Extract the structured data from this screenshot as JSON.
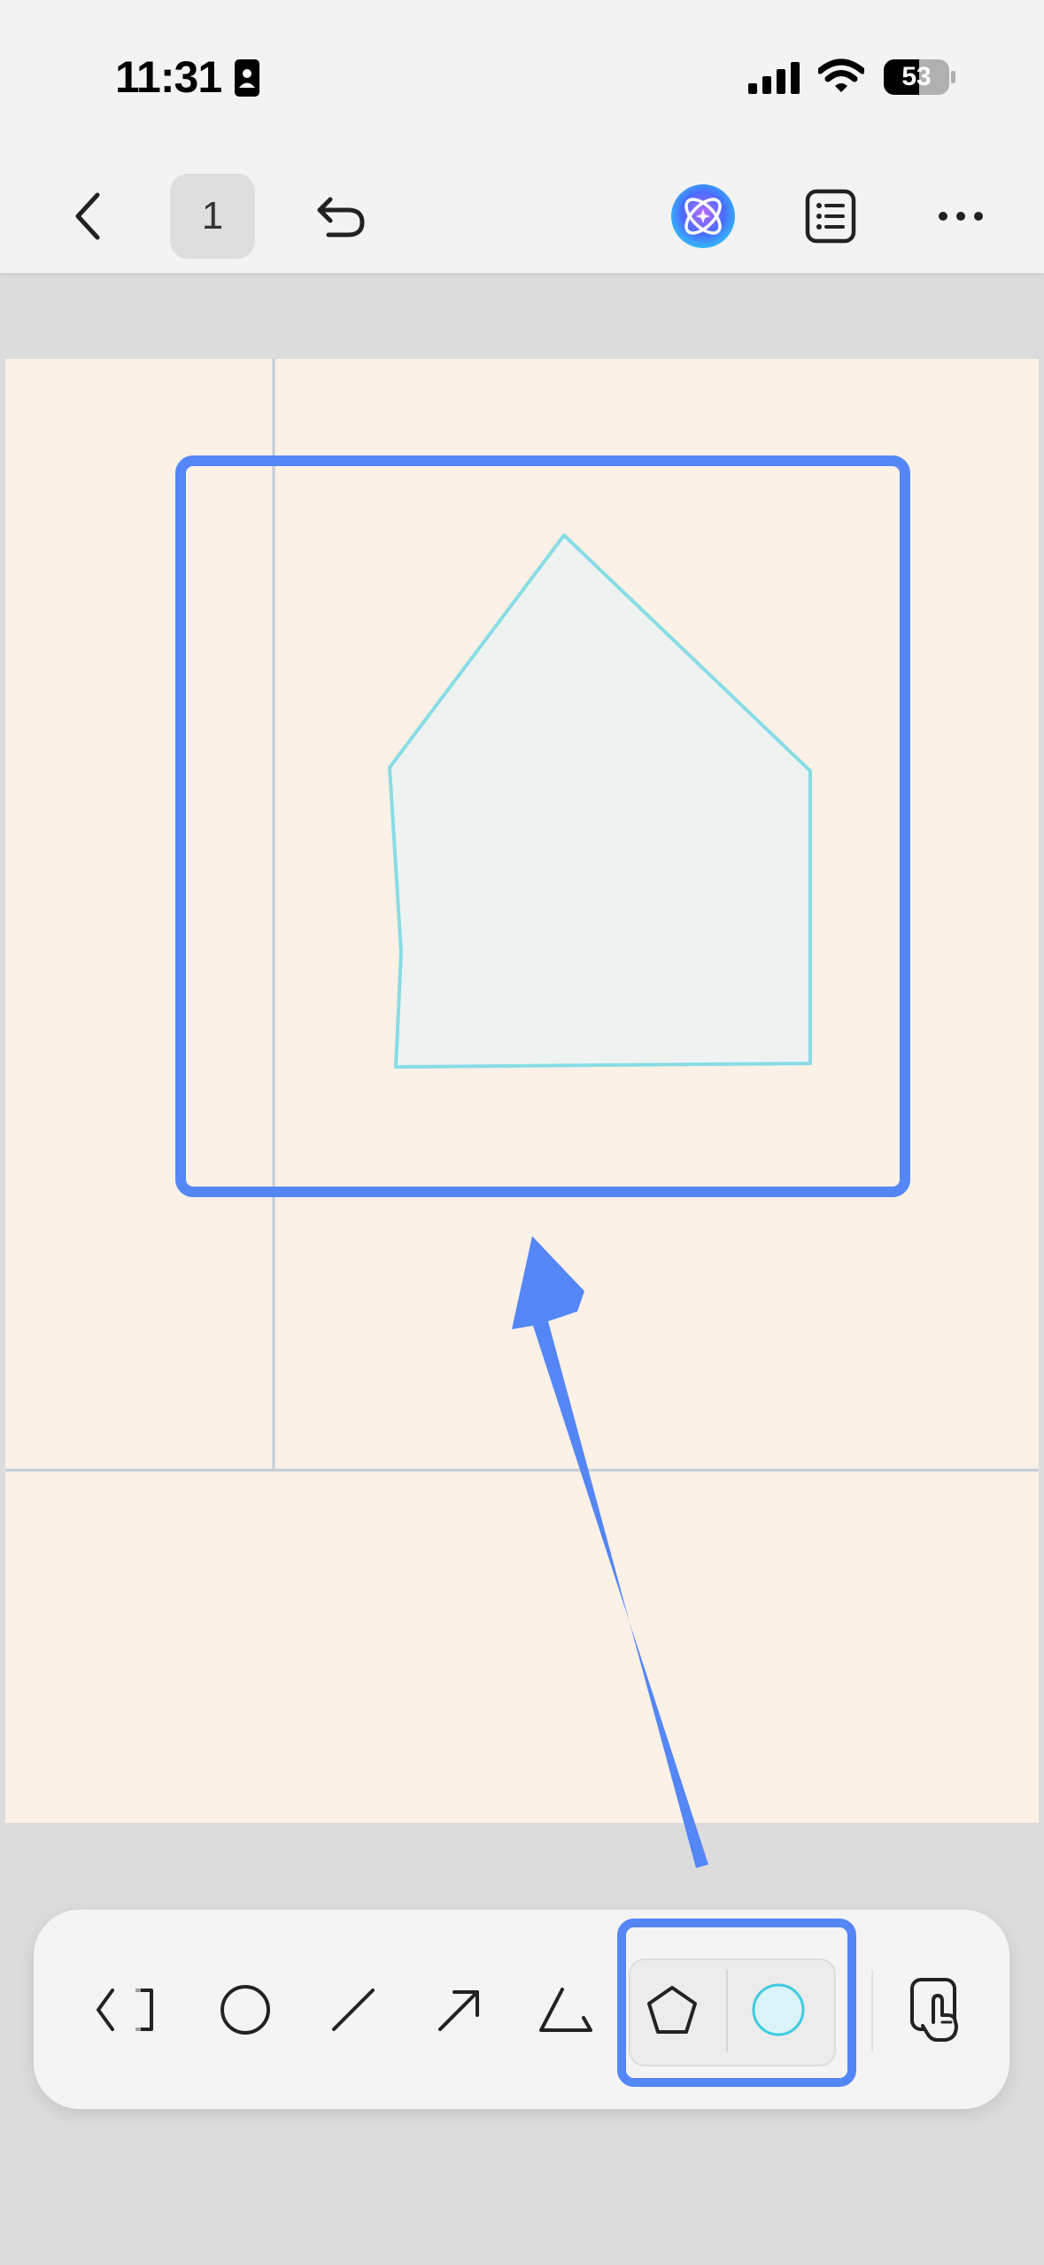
{
  "status_bar": {
    "time": "11:31",
    "battery_level": "53",
    "icons": [
      "contact-card-icon",
      "cellular-signal-icon",
      "wifi-icon",
      "battery-icon"
    ]
  },
  "nav_bar": {
    "page_number": "1",
    "icons": [
      "back-chevron-icon",
      "undo-icon",
      "ai-assistant-icon",
      "list-icon",
      "more-icon"
    ]
  },
  "canvas": {
    "background_color": "#fbf1e6",
    "guide_line_color": "#c4ccd6",
    "pentagon_stroke_color": "#88dce6",
    "pentagon_fill_color": "#eef3f1"
  },
  "toolbar": {
    "tools": [
      {
        "name": "eraser-select-tool",
        "icon": "bracket-icon"
      },
      {
        "name": "circle-tool",
        "icon": "circle-icon"
      },
      {
        "name": "line-tool",
        "icon": "line-icon"
      },
      {
        "name": "arrow-tool",
        "icon": "arrow-icon"
      },
      {
        "name": "triangle-tool",
        "icon": "triangle-icon"
      },
      {
        "name": "pentagon-tool",
        "icon": "pentagon-icon"
      },
      {
        "name": "color-swatch",
        "icon": "color-circle-icon",
        "color": "#d9f3f8"
      },
      {
        "name": "touch-mode-tool",
        "icon": "hand-touch-icon"
      }
    ]
  },
  "annotation": {
    "highlight_color": "#5486f5"
  }
}
